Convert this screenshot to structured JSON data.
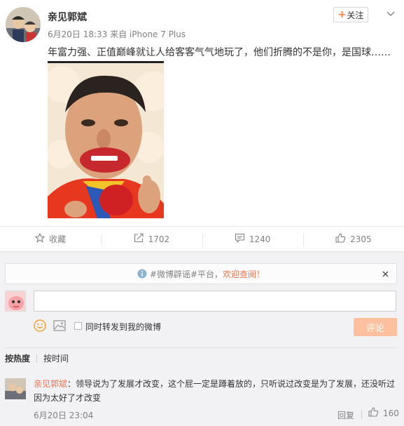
{
  "post": {
    "author": "亲见郭斌",
    "meta": "6月20日 18:33 来自 iPhone 7 Plus",
    "text": "年富力强、正值巅峰就让人给客客气气地玩了，他们折腾的不是你，是国球……",
    "follow_label": "关注",
    "image_desc": "caricature"
  },
  "actions": [
    {
      "icon": "star-icon",
      "label": "收藏"
    },
    {
      "icon": "share-icon",
      "label": "1702"
    },
    {
      "icon": "comment-icon",
      "label": "1240"
    },
    {
      "icon": "thumbs-up-icon",
      "label": "2305"
    }
  ],
  "notice": {
    "prefix": "#微博辟谣#平台，",
    "link": "欢迎查阅！"
  },
  "composer": {
    "repost_label": "同时转发到我的微博",
    "submit_label": "评论"
  },
  "sort": {
    "hot": "按热度",
    "time": "按时间"
  },
  "comments": [
    {
      "user": "亲见郭斌",
      "text": "：领导说为了发展才改变，这个屁一定是蹲着放的，只听说过改变是为了发展，还没听过因为太好了才改变",
      "time": "6月20日 23:04",
      "reply_label": "回复",
      "likes": "160"
    }
  ],
  "colors": {
    "accent": "#eb7350",
    "follow_plus": "#ff8140",
    "submit_disabled": "#ffc09f"
  }
}
